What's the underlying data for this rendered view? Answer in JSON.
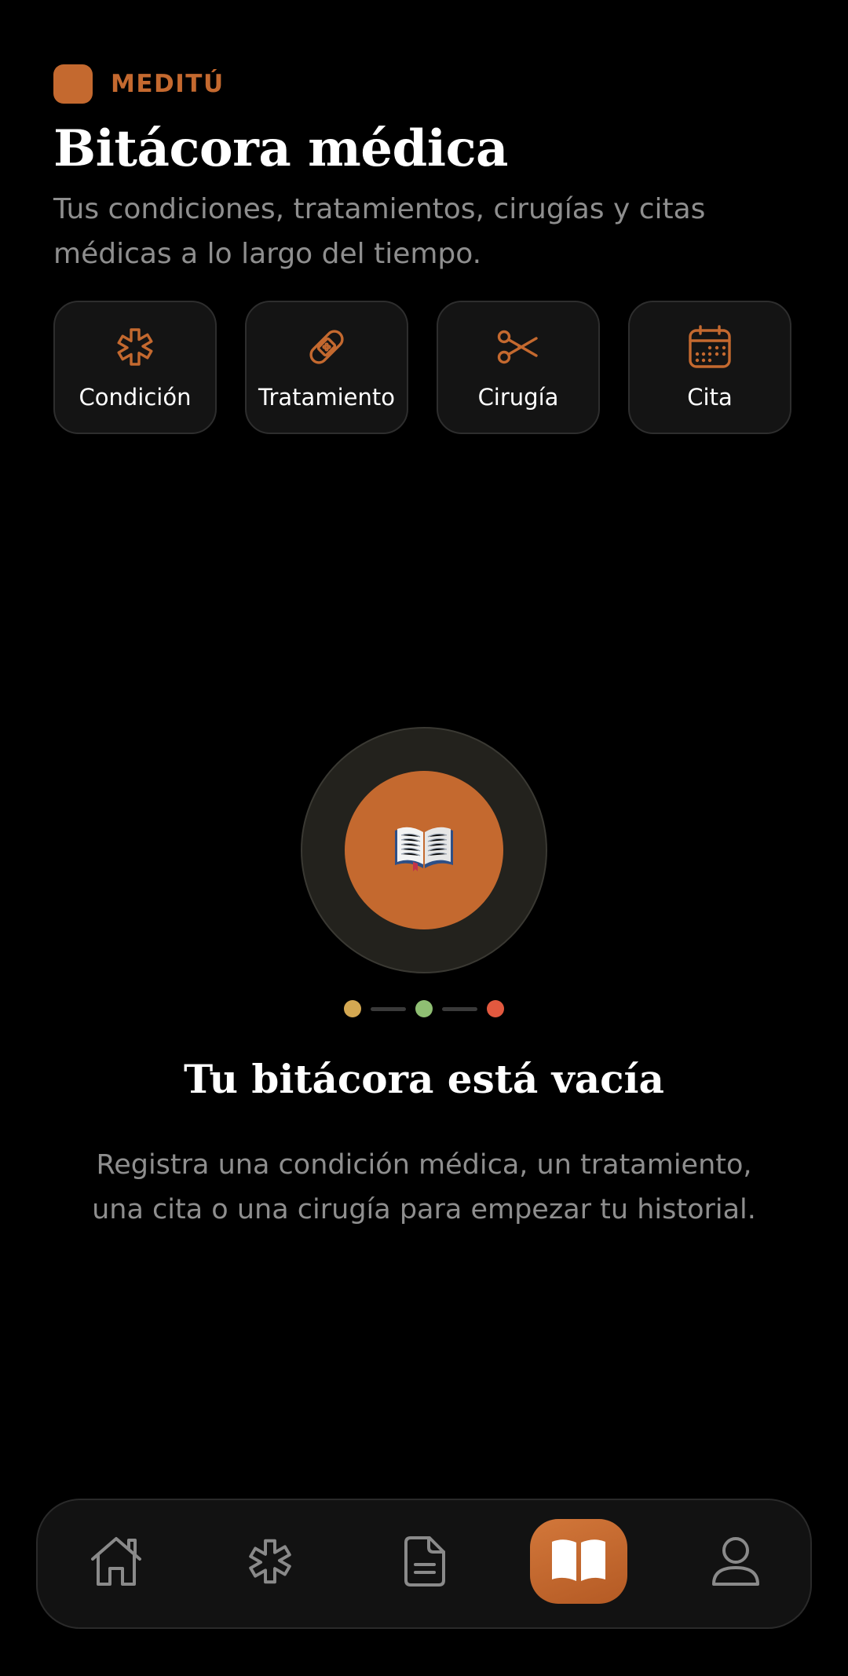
{
  "brand": {
    "name": "MEDITÚ",
    "color": "#c4692f"
  },
  "header": {
    "title": "Bitácora médica",
    "subtitle": "Tus condiciones, tratamientos, cirugías y citas médicas a lo largo del tiempo."
  },
  "quick_actions": [
    {
      "label": "Condición",
      "icon": "asterisk-icon"
    },
    {
      "label": "Tratamiento",
      "icon": "bandage-icon"
    },
    {
      "label": "Cirugía",
      "icon": "scissors-icon"
    },
    {
      "label": "Cita",
      "icon": "calendar-icon"
    }
  ],
  "empty_state": {
    "icon": "open-book-icon",
    "emoji": "📖",
    "dot_colors": [
      "#d4a852",
      "#8fbf73",
      "#e2593f"
    ],
    "title": "Tu bitácora está vacía",
    "description": "Registra una condición médica, un tratamiento, una cita o una cirugía para empezar tu historial."
  },
  "bottom_nav": {
    "items": [
      {
        "icon": "home-icon",
        "active": false
      },
      {
        "icon": "asterisk-icon",
        "active": false
      },
      {
        "icon": "document-icon",
        "active": false
      },
      {
        "icon": "open-book-icon",
        "active": true
      },
      {
        "icon": "user-icon",
        "active": false
      }
    ],
    "accent": "#c4692f",
    "inactive_color": "#8a8a8a"
  }
}
